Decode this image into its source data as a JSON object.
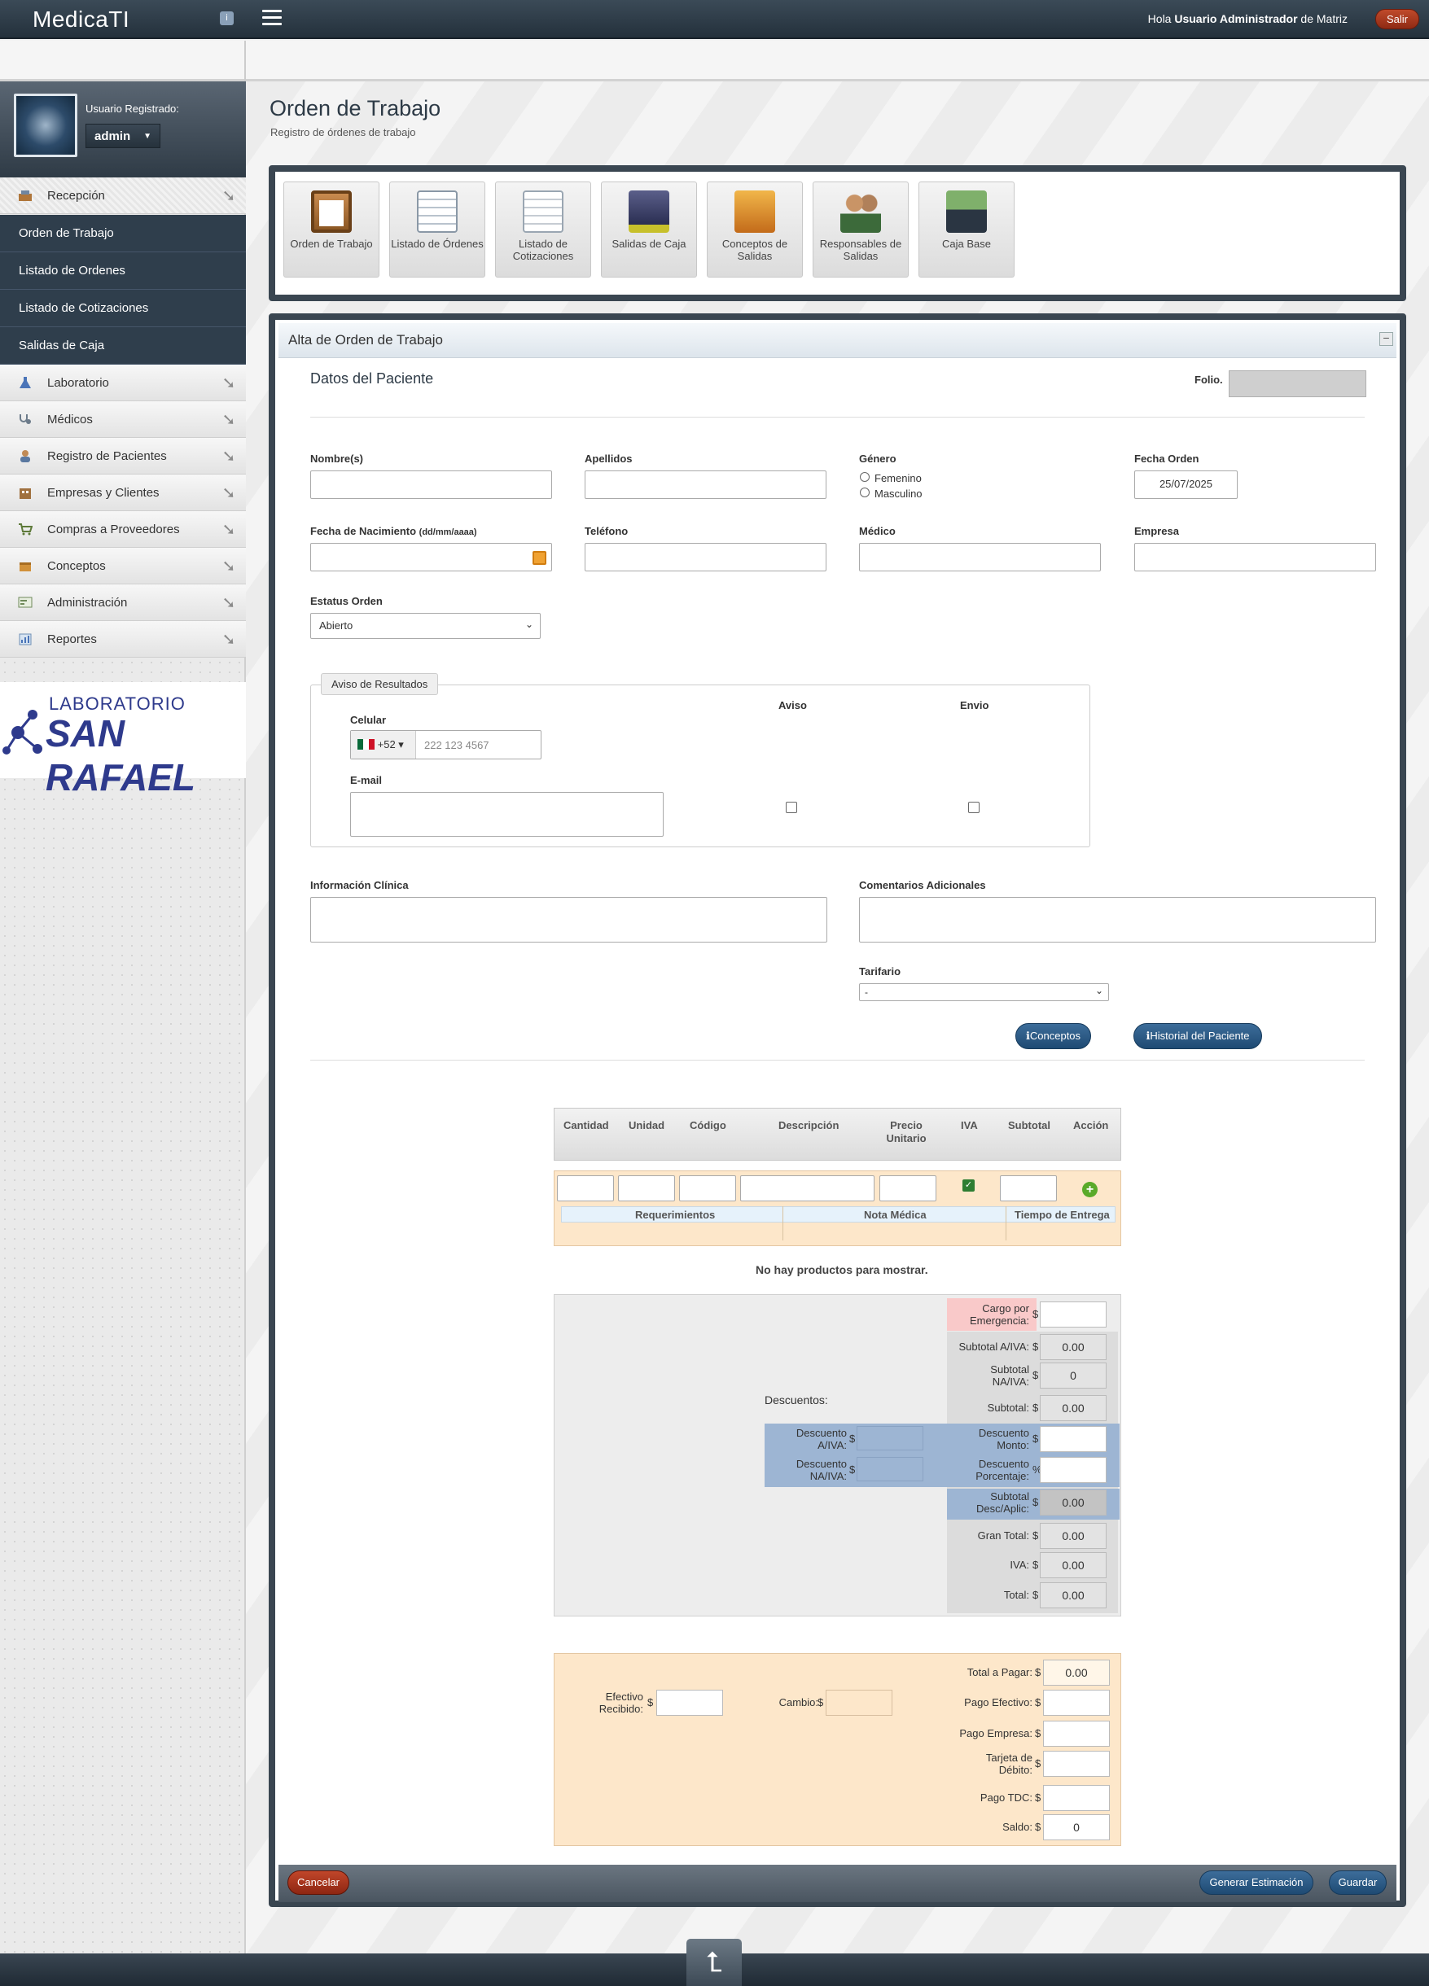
{
  "app": {
    "title": "MedicaTI",
    "greeting_prefix": "Hola ",
    "user_name": "Usuario Administrador",
    "greeting_suffix": " de Matriz",
    "logout_label": "Salir"
  },
  "sidebar": {
    "registered_label": "Usuario Registrado:",
    "user": "admin",
    "reception_label": "Recepción",
    "submenu": [
      "Orden de Trabajo",
      "Listado de Ordenes",
      "Listado de Cotizaciones",
      "Salidas de Caja"
    ],
    "items": [
      "Laboratorio",
      "Médicos",
      "Registro de Pacientes",
      "Empresas y Clientes",
      "Compras a Proveedores",
      "Conceptos",
      "Administración",
      "Reportes"
    ],
    "brand_line1": "LABORATORIO",
    "brand_line2": "SAN RAFAEL"
  },
  "page": {
    "title": "Orden de Trabajo",
    "subtitle": "Registro de órdenes de trabajo"
  },
  "toolbar": [
    {
      "label": "Orden de Trabajo",
      "icon": "clipboard-icon"
    },
    {
      "label": "Listado de Órdenes",
      "icon": "list-icon"
    },
    {
      "label": "Listado de Cotizaciones",
      "icon": "quote-list-icon"
    },
    {
      "label": "Salidas de Caja",
      "icon": "cash-register-icon"
    },
    {
      "label": "Conceptos de Salidas",
      "icon": "concepts-icon"
    },
    {
      "label": "Responsables de Salidas",
      "icon": "people-icon"
    },
    {
      "label": "Caja Base",
      "icon": "cash-box-icon"
    }
  ],
  "form": {
    "panel_title": "Alta de Orden de Trabajo",
    "section_title": "Datos del Paciente",
    "folio_label": "Folio.",
    "nombres_label": "Nombre(s)",
    "apellidos_label": "Apellidos",
    "genero_label": "Género",
    "genero_opts": [
      "Femenino",
      "Masculino"
    ],
    "fecha_orden_label": "Fecha Orden",
    "fecha_orden_value": "25/07/2025",
    "nacimiento_label": "Fecha de Nacimiento",
    "nacimiento_hint": "(dd/mm/aaaa)",
    "telefono_label": "Teléfono",
    "medico_label": "Médico",
    "empresa_label": "Empresa",
    "estatus_label": "Estatus Orden",
    "estatus_value": "Abierto",
    "aviso_legend": "Aviso de Resultados",
    "aviso_label": "Aviso",
    "envio_label": "Envio",
    "celular_label": "Celular",
    "country_code": "+52",
    "celular_placeholder": "222 123 4567",
    "email_label": "E-mail",
    "info_clinica_label": "Información Clínica",
    "comentarios_label": "Comentarios Adicionales",
    "tarifario_label": "Tarifario",
    "tarifario_value": "-",
    "conceptos_btn": "Conceptos",
    "historial_btn": "Historial del Paciente"
  },
  "products": {
    "headers": [
      "Cantidad",
      "Unidad",
      "Código",
      "Descripción",
      "Precio Unitario",
      "IVA",
      "Subtotal",
      "Acción"
    ],
    "sub_headers": [
      "Requerimientos",
      "Nota Médica",
      "Tiempo de Entrega"
    ],
    "empty_msg": "No hay productos para mostrar."
  },
  "totals": {
    "cargo_label": "Cargo por Emergencia:",
    "subtotal_aiva_label": "Subtotal A/IVA:",
    "subtotal_aiva": "0.00",
    "subtotal_naiva_label": "Subtotal NA/IVA:",
    "subtotal_naiva": "0",
    "subtotal_label": "Subtotal:",
    "subtotal": "0.00",
    "descuentos_label": "Descuentos:",
    "desc_aiva_label": "Descuento A/IVA:",
    "desc_naiva_label": "Descuento NA/IVA:",
    "desc_monto_label": "Descuento Monto:",
    "desc_pct_label": "Descuento Porcentaje:",
    "subtotal_desc_label": "Subtotal Desc/Aplic:",
    "subtotal_desc": "0.00",
    "gran_total_label": "Gran Total:",
    "gran_total": "0.00",
    "iva_label": "IVA:",
    "iva": "0.00",
    "total_label": "Total:",
    "total": "0.00"
  },
  "payment": {
    "efectivo_label": "Efectivo Recibido:",
    "cambio_label": "Cambio:",
    "total_pagar_label": "Total a Pagar:",
    "total_pagar": "0.00",
    "pago_efectivo_label": "Pago Efectivo:",
    "pago_empresa_label": "Pago Empresa:",
    "tarjeta_debito_label": "Tarjeta de Débito:",
    "pago_tdc_label": "Pago TDC:",
    "saldo_label": "Saldo:",
    "saldo": "0"
  },
  "footer": {
    "cancel": "Cancelar",
    "estimate": "Generar Estimación",
    "save": "Guardar"
  },
  "colors": {
    "nav_dark": "#2f3e4c",
    "accent_blue": "#1e4a73",
    "danger": "#a8341c",
    "payment_bg": "#fde7ca",
    "discount_bg": "#9db5d3"
  }
}
